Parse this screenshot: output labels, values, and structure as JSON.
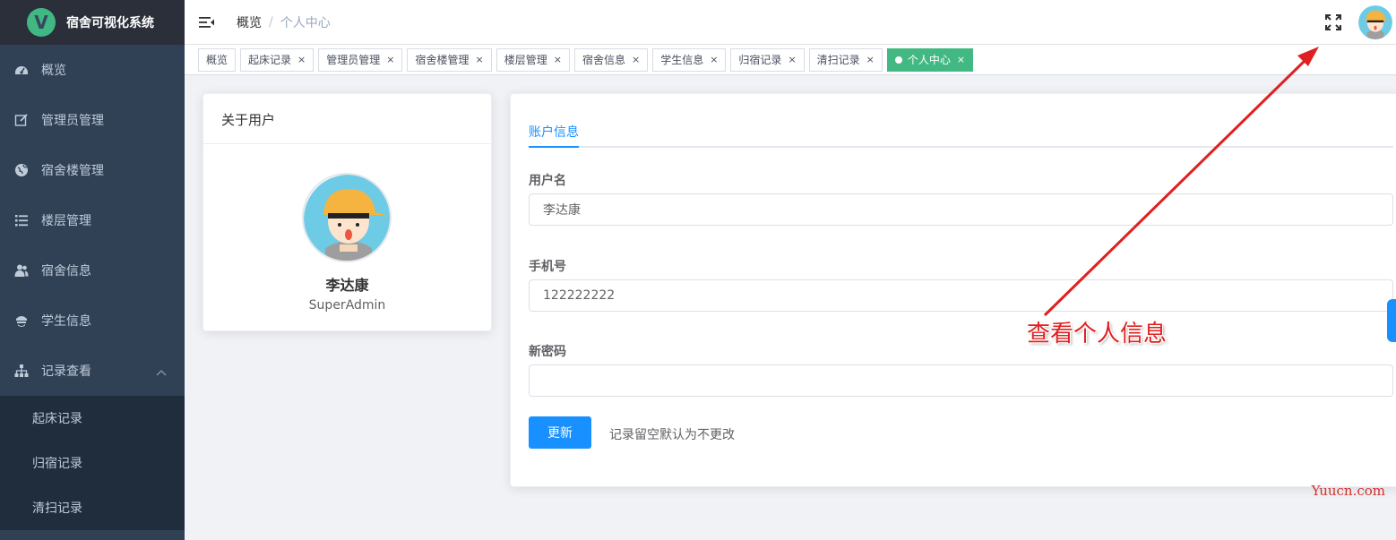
{
  "app": {
    "title": "宿舍可视化系统",
    "logo_letter": "V"
  },
  "sidebar": {
    "items": [
      {
        "label": "概览",
        "icon": "dashboard-icon"
      },
      {
        "label": "管理员管理",
        "icon": "edit-icon"
      },
      {
        "label": "宿舍楼管理",
        "icon": "globe-icon"
      },
      {
        "label": "楼层管理",
        "icon": "list-icon"
      },
      {
        "label": "宿舍信息",
        "icon": "users-icon"
      },
      {
        "label": "学生信息",
        "icon": "student-icon"
      },
      {
        "label": "记录查看",
        "icon": "sitemap-icon"
      }
    ],
    "submenu": [
      "起床记录",
      "归宿记录",
      "清扫记录"
    ]
  },
  "breadcrumb": {
    "first": "概览",
    "separator": "/",
    "current": "个人中心"
  },
  "tags": [
    {
      "label": "概览",
      "closable": false
    },
    {
      "label": "起床记录",
      "closable": true
    },
    {
      "label": "管理员管理",
      "closable": true
    },
    {
      "label": "宿舍楼管理",
      "closable": true
    },
    {
      "label": "楼层管理",
      "closable": true
    },
    {
      "label": "宿舍信息",
      "closable": true
    },
    {
      "label": "学生信息",
      "closable": true
    },
    {
      "label": "归宿记录",
      "closable": true
    },
    {
      "label": "清扫记录",
      "closable": true
    },
    {
      "label": "个人中心",
      "closable": true,
      "active": true
    }
  ],
  "tag_close_glyph": "×",
  "user_card": {
    "header": "关于用户",
    "name": "李达康",
    "role": "SuperAdmin"
  },
  "form": {
    "tab": "账户信息",
    "username_label": "用户名",
    "username_value": "李达康",
    "phone_label": "手机号",
    "phone_value": "122222222",
    "password_label": "新密码",
    "password_value": "",
    "submit_label": "更新",
    "hint": "记录留空默认为不更改"
  },
  "annotation": {
    "text": "查看个人信息"
  },
  "watermark": "Yuucn.com",
  "colors": {
    "sidebar": "#304156",
    "active_tag": "#42b983",
    "primary": "#1890ff",
    "annotation": "#e02020"
  }
}
